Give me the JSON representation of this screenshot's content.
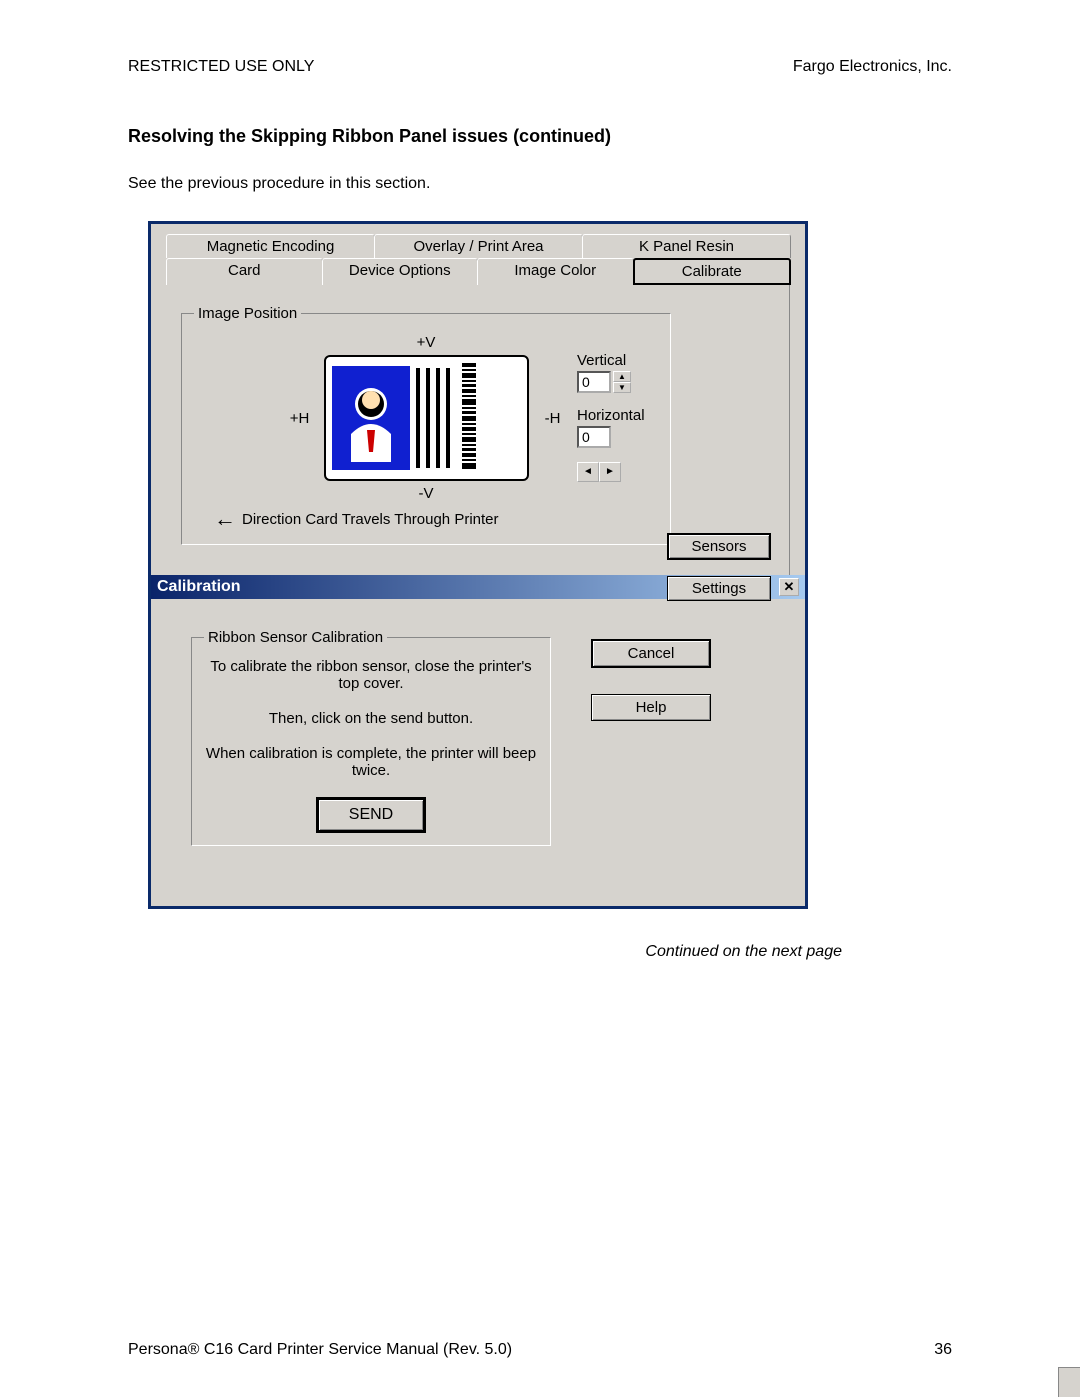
{
  "header": {
    "left": "RESTRICTED USE ONLY",
    "right": "Fargo Electronics, Inc."
  },
  "title": "Resolving the Skipping Ribbon Panel issues (continued)",
  "intro": "See the previous procedure in this section.",
  "tabs": {
    "row1": [
      "Magnetic Encoding",
      "Overlay / Print Area",
      "K Panel Resin"
    ],
    "row2": [
      "Card",
      "Device Options",
      "Image Color",
      "Calibrate"
    ],
    "active": "Calibrate"
  },
  "imagePosition": {
    "legend": "Image Position",
    "plusV": "+V",
    "minusV": "-V",
    "plusH": "+H",
    "minusH": "-H",
    "vertical_label": "Vertical",
    "vertical_value": "0",
    "horizontal_label": "Horizontal",
    "horizontal_value": "0",
    "direction_text": "Direction Card Travels Through Printer"
  },
  "side_buttons": {
    "sensors": "Sensors",
    "settings": "Settings"
  },
  "dialog": {
    "title": "Calibration",
    "group_legend": "Ribbon Sensor Calibration",
    "line1": "To calibrate the ribbon sensor, close the printer's top cover.",
    "line2": "Then, click on the send button.",
    "line3": "When calibration is complete, the printer will beep twice.",
    "send": "SEND",
    "cancel": "Cancel",
    "help": "Help"
  },
  "continued": "Continued on the next page",
  "footer": {
    "left": "Persona® C16 Card Printer Service Manual (Rev. 5.0)",
    "right": "36"
  }
}
